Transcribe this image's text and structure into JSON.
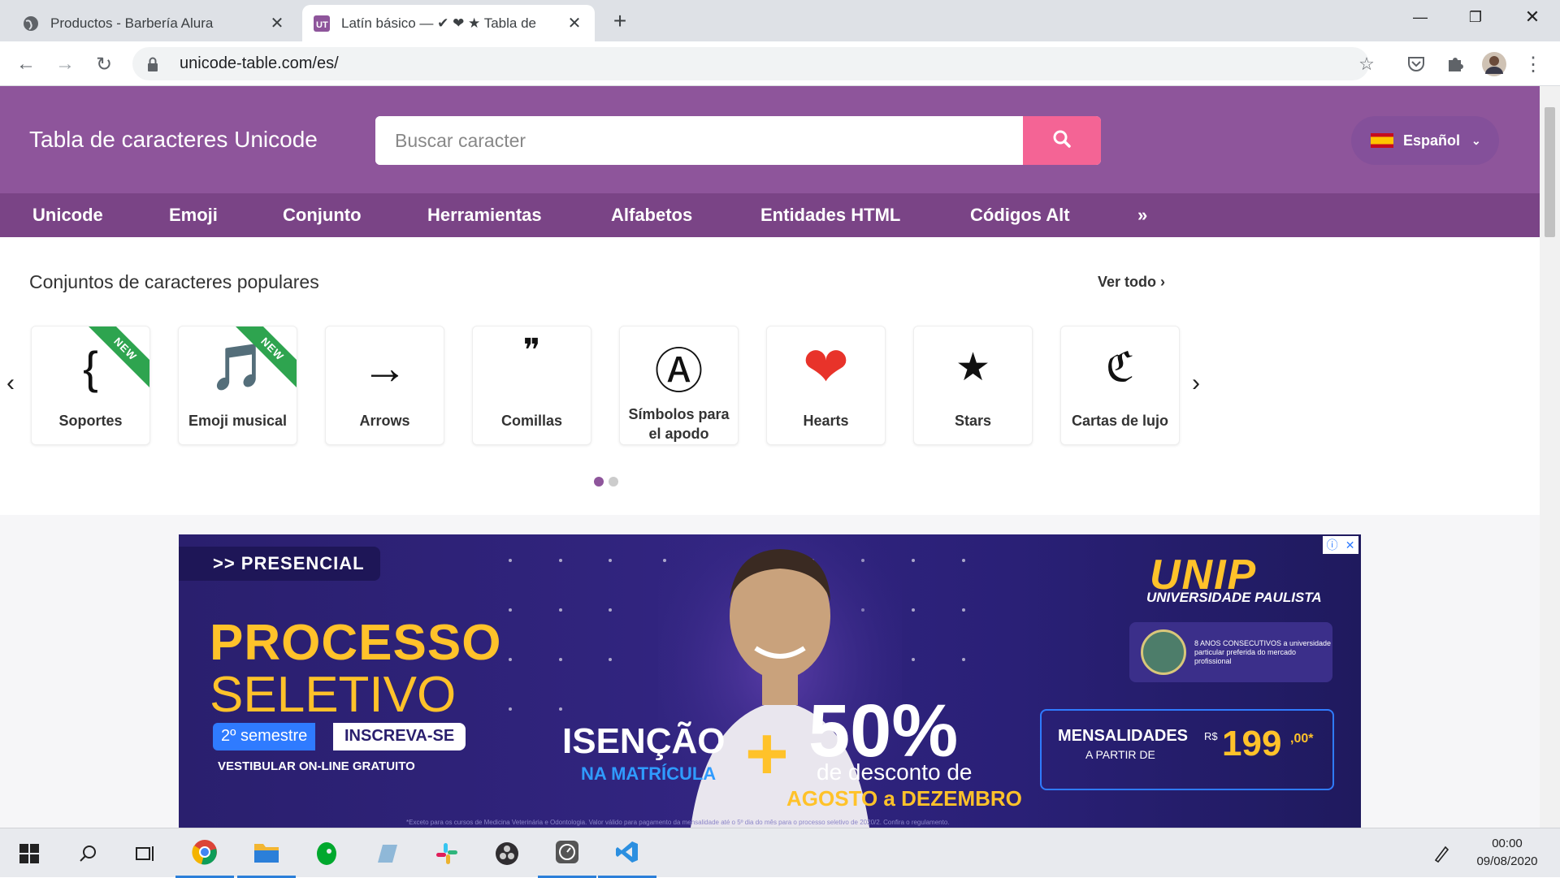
{
  "browser": {
    "tabs": [
      {
        "title": "Productos - Barbería Alura",
        "active": false
      },
      {
        "title": "Latín básico — ✔ ❤ ★ Tabla de",
        "active": true
      }
    ],
    "new_tab": "+",
    "url": "unicode-table.com/es/"
  },
  "site": {
    "title": "Tabla de caracteres Unicode",
    "search_placeholder": "Buscar caracter",
    "language": "Español",
    "nav": [
      "Unicode",
      "Emoji",
      "Conjunto",
      "Herramientas",
      "Alfabetos",
      "Entidades HTML",
      "Códigos Alt",
      "»"
    ]
  },
  "popular": {
    "title": "Conjuntos de caracteres populares",
    "see_all": "Ver todo ›",
    "prev": "‹",
    "next": "›",
    "cards": [
      {
        "glyph": "{",
        "label": "Soportes",
        "badge": "NEW"
      },
      {
        "glyph": "🎵",
        "label": "Emoji musical",
        "badge": "NEW"
      },
      {
        "glyph": "→",
        "label": "Arrows",
        "badge": ""
      },
      {
        "glyph": "❞",
        "label": "Comillas",
        "badge": ""
      },
      {
        "glyph": "Ⓐ",
        "label": "Símbolos para el apodo",
        "badge": ""
      },
      {
        "glyph": "❤",
        "label": "Hearts",
        "badge": ""
      },
      {
        "glyph": "★",
        "label": "Stars",
        "badge": ""
      },
      {
        "glyph": "ℭ",
        "label": "Cartas de lujo",
        "badge": ""
      }
    ],
    "page_dots": 2,
    "active_dot": 1
  },
  "ad": {
    "pill": ">> PRESENCIAL",
    "headline1": "PROCESSO",
    "headline2": "SELETIVO",
    "semester": "2º semestre",
    "cta": "INSCREVA-SE",
    "vestibular": "VESTIBULAR ON-LINE GRATUITO",
    "isencao": "ISENÇÃO",
    "matricula": "NA MATRÍCULA",
    "plus": "+",
    "discount": "50%",
    "discount_desc": "de desconto de",
    "period": "AGOSTO a DEZEMBRO",
    "brand": "UNIP",
    "brand_sub": "UNIVERSIDADE PAULISTA",
    "badge_text": "8 ANOS CONSECUTIVOS a universidade particular preferida do mercado profissional",
    "mensalidades": "MENSALIDADES",
    "a_partir": "A PARTIR DE",
    "currency": "R$",
    "price": "199",
    "cents": ",00*",
    "fine_print": "*Exceto para os cursos de Medicina Veterinária e Odontologia. Valor válido para pagamento da mensalidade até o 5º dia do mês para o processo seletivo de 2020/2. Confira o regulamento."
  },
  "taskbar": {
    "time": "00:00",
    "date": "09/08/2020"
  },
  "colors": {
    "header": "#8e559b",
    "nav": "#7a4486",
    "search_button": "#f46495",
    "ribbon": "#2ea44f",
    "ad_yellow": "#ffc22a"
  }
}
